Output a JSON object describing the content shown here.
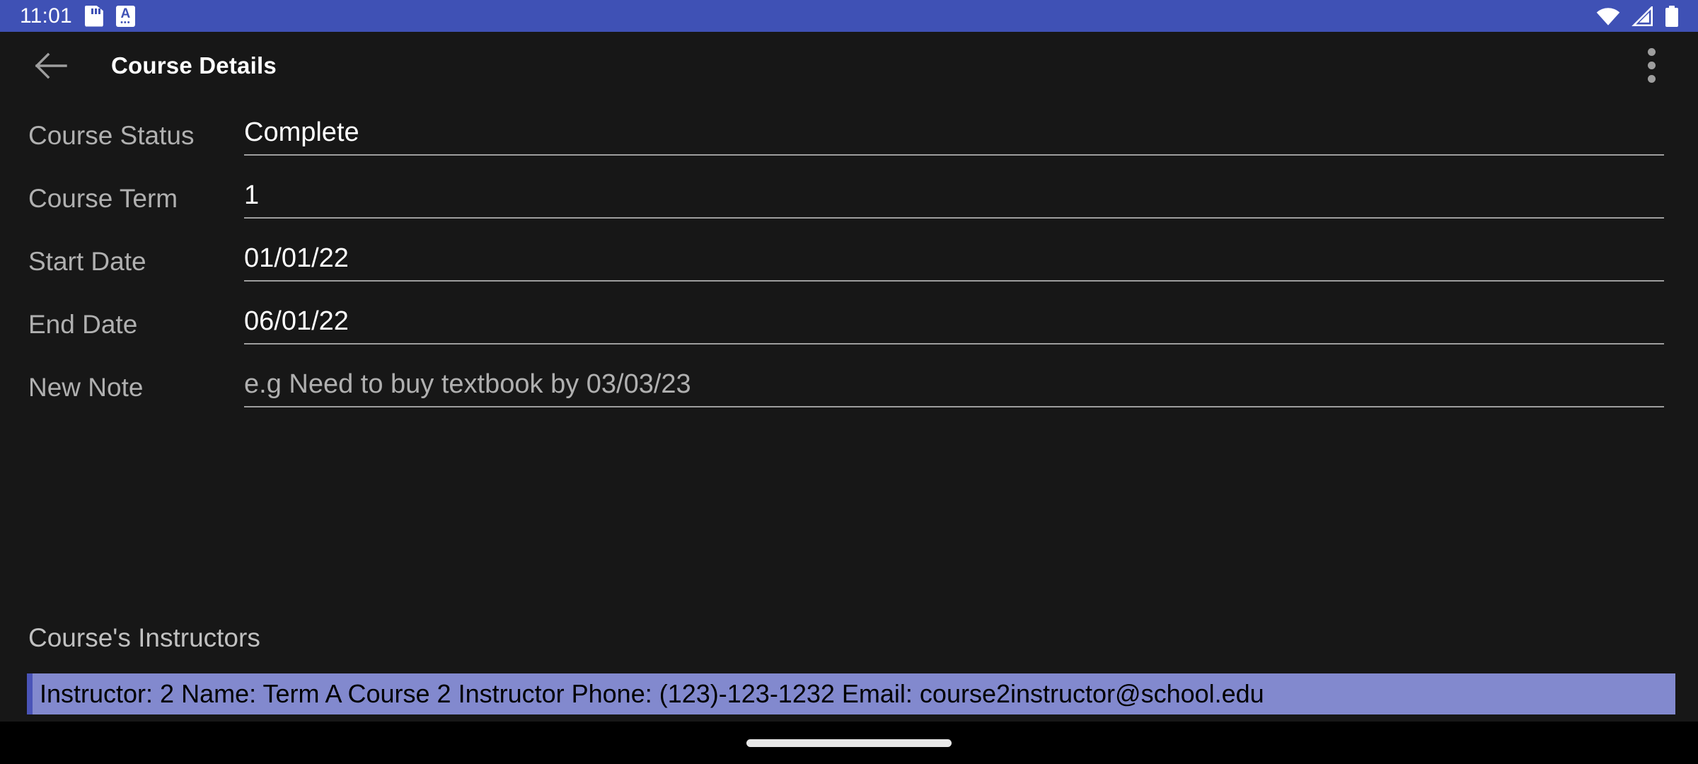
{
  "status_bar": {
    "clock": "11:01",
    "background_color": "#3f51b5",
    "left_icons": [
      {
        "name": "sd-card-icon",
        "label": "SD card"
      },
      {
        "name": "document-a-icon",
        "label": "A"
      }
    ],
    "right_icons": [
      {
        "name": "wifi-icon",
        "label": "Wi-Fi"
      },
      {
        "name": "cellular-signal-icon",
        "label": "Cellular signal"
      },
      {
        "name": "battery-icon",
        "label": "Battery"
      }
    ],
    "doc_icon_letter": "A",
    "doc_icon_dots": "•••"
  },
  "toolbar": {
    "back_icon": "arrow-left-icon",
    "title": "Course Details",
    "overflow_icon": "more-vertical-icon",
    "background_color": "#171717"
  },
  "form": {
    "fields": [
      {
        "label": "Course Status",
        "value": "Complete",
        "is_placeholder": false
      },
      {
        "label": "Course Term",
        "value": "1",
        "is_placeholder": false
      },
      {
        "label": "Start Date",
        "value": "01/01/22",
        "is_placeholder": false
      },
      {
        "label": "End Date",
        "value": "06/01/22",
        "is_placeholder": false
      },
      {
        "label": "New Note",
        "value": "e.g Need to buy textbook by 03/03/23",
        "is_placeholder": true
      }
    ]
  },
  "instructors": {
    "header": "Course's Instructors",
    "selected_row_background": "#8289ce",
    "selected_row_accent": "#4a54b8",
    "rows": [
      {
        "text": "Instructor: 2 Name: Term A Course 2 Instructor Phone: (123)-123-1232 Email: course2instructor@school.edu",
        "selected": true
      }
    ]
  },
  "nav_bar": {
    "gesture_pill": "home-gesture-pill",
    "background_color": "#000000"
  },
  "colors": {
    "accent": "#3f51b5",
    "surface": "#171717",
    "label_text": "#b0b0b0",
    "value_text": "#ffffff"
  }
}
